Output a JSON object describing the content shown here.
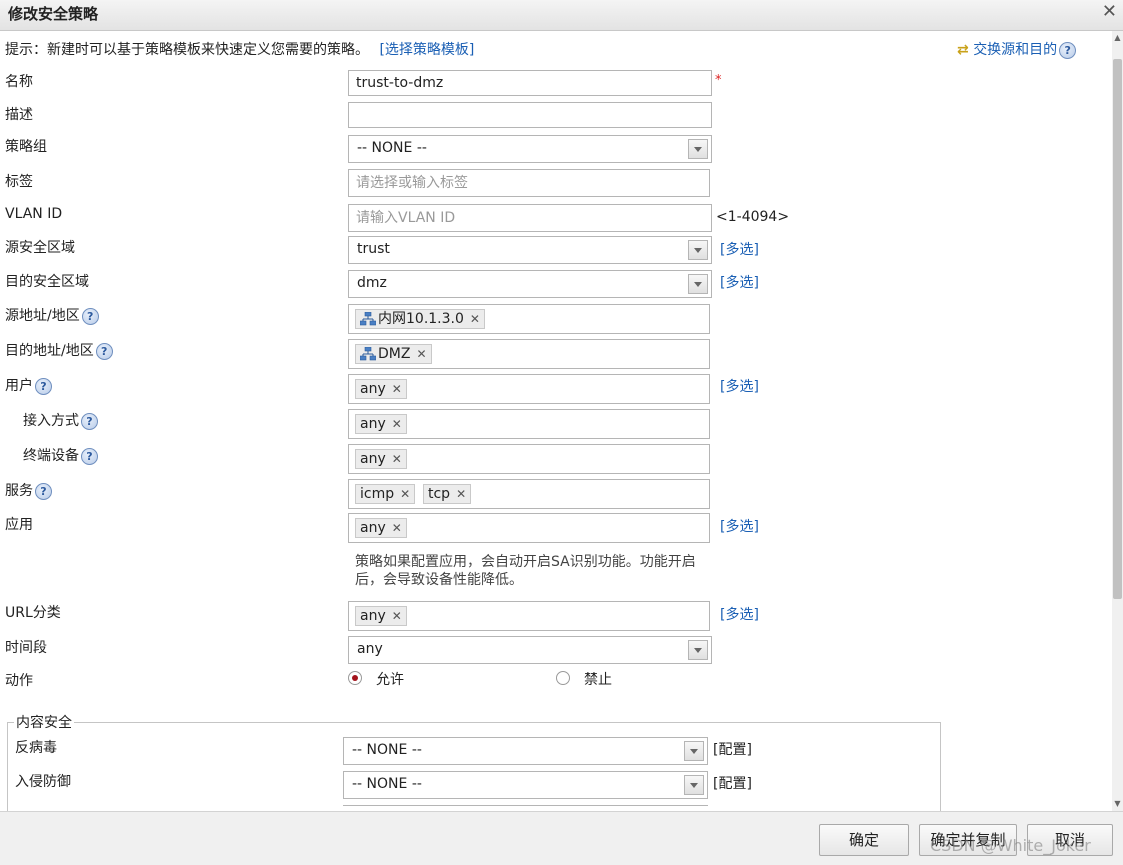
{
  "dialog": {
    "title": "修改安全策略"
  },
  "hint": {
    "text": "提示：新建时可以基于策略模板来快速定义您需要的策略。",
    "template_link": "[选择策略模板]",
    "swap_link": "交换源和目的"
  },
  "fields": {
    "name": {
      "label": "名称",
      "value": "trust-to-dmz",
      "required_mark": "*"
    },
    "description": {
      "label": "描述",
      "value": ""
    },
    "policy_group": {
      "label": "策略组",
      "value": "-- NONE --"
    },
    "tag": {
      "label": "标签",
      "placeholder": "请选择或输入标签"
    },
    "vlan_id": {
      "label": "VLAN ID",
      "placeholder": "请输入VLAN ID",
      "range": "<1-4094>"
    },
    "src_zone": {
      "label": "源安全区域",
      "value": "trust",
      "multi": "[多选]"
    },
    "dst_zone": {
      "label": "目的安全区域",
      "value": "dmz",
      "multi": "[多选]"
    },
    "src_addr": {
      "label": "源地址/地区",
      "tags": [
        "内网10.1.3.0"
      ]
    },
    "dst_addr": {
      "label": "目的地址/地区",
      "tags": [
        "DMZ"
      ]
    },
    "user": {
      "label": "用户",
      "tags": [
        "any"
      ],
      "multi": "[多选]"
    },
    "access_mode": {
      "label": "接入方式",
      "tags": [
        "any"
      ]
    },
    "terminal": {
      "label": "终端设备",
      "tags": [
        "any"
      ]
    },
    "service": {
      "label": "服务",
      "tags": [
        "icmp",
        "tcp"
      ]
    },
    "application": {
      "label": "应用",
      "tags": [
        "any"
      ],
      "multi": "[多选]",
      "note_line1": "策略如果配置应用，会自动开启SA识别功能。功能开启",
      "note_line2": "后，会导致设备性能降低。"
    },
    "url_category": {
      "label": "URL分类",
      "tags": [
        "any"
      ],
      "multi": "[多选]"
    },
    "time_range": {
      "label": "时间段",
      "value": "any"
    },
    "action": {
      "label": "动作",
      "allow": "允许",
      "deny": "禁止",
      "selected": "allow"
    }
  },
  "content_security": {
    "legend": "内容安全",
    "antivirus": {
      "label": "反病毒",
      "value": "-- NONE --",
      "config": "[配置]"
    },
    "ips": {
      "label": "入侵防御",
      "value": "-- NONE --",
      "config": "[配置]"
    }
  },
  "footer": {
    "ok": "确定",
    "ok_copy": "确定并复制",
    "cancel": "取消"
  },
  "watermark": "CSDN @White_Joker",
  "colors": {
    "link": "#1a5fb4",
    "required": "#dd2222",
    "radio_selected": "#a3121b"
  }
}
